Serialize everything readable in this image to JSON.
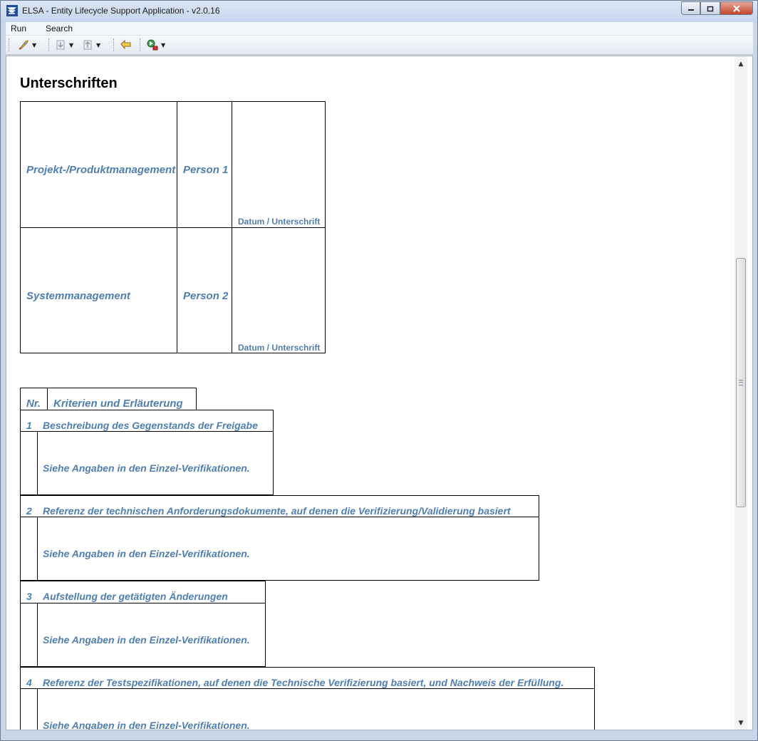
{
  "window": {
    "title": "ELSA - Entity Lifecycle Support Application - v2.0.16"
  },
  "menu": {
    "items": [
      "Run",
      "Search"
    ]
  },
  "toolbar": {
    "icons": [
      "rocket-icon",
      "import-icon",
      "export-icon",
      "back-arrow-icon",
      "run-search-icon"
    ]
  },
  "document": {
    "heading": "Unterschriften",
    "signatures": [
      {
        "role": "Projekt-/Produktmanagement",
        "person": "Person 1",
        "sign_label": "Datum / Unterschrift"
      },
      {
        "role": "Systemmanagement",
        "person": "Person 2",
        "sign_label": "Datum / Unterschrift"
      }
    ],
    "criteria_header": {
      "nr": "Nr.",
      "title": "Kriterien und Erläuterung"
    },
    "criteria": [
      {
        "nr": "1",
        "title": "Beschreibung des Gegenstands der Freigabe",
        "text": "Siehe Angaben in den Einzel-Verifikationen."
      },
      {
        "nr": "2",
        "title": "Referenz der technischen Anforderungsdokumente, auf denen die Verifizierung/Validierung basiert",
        "text": "Siehe Angaben in den Einzel-Verifikationen."
      },
      {
        "nr": "3",
        "title": "Aufstellung der getätigten Änderungen",
        "text": "Siehe Angaben in den Einzel-Verifikationen."
      },
      {
        "nr": "4",
        "title": "Referenz der Testspezifikationen, auf denen die Technische Verifizierung basiert, und Nachweis der Erfüllung.",
        "text": "Siehe Angaben in den Einzel-Verifikationen."
      }
    ]
  }
}
